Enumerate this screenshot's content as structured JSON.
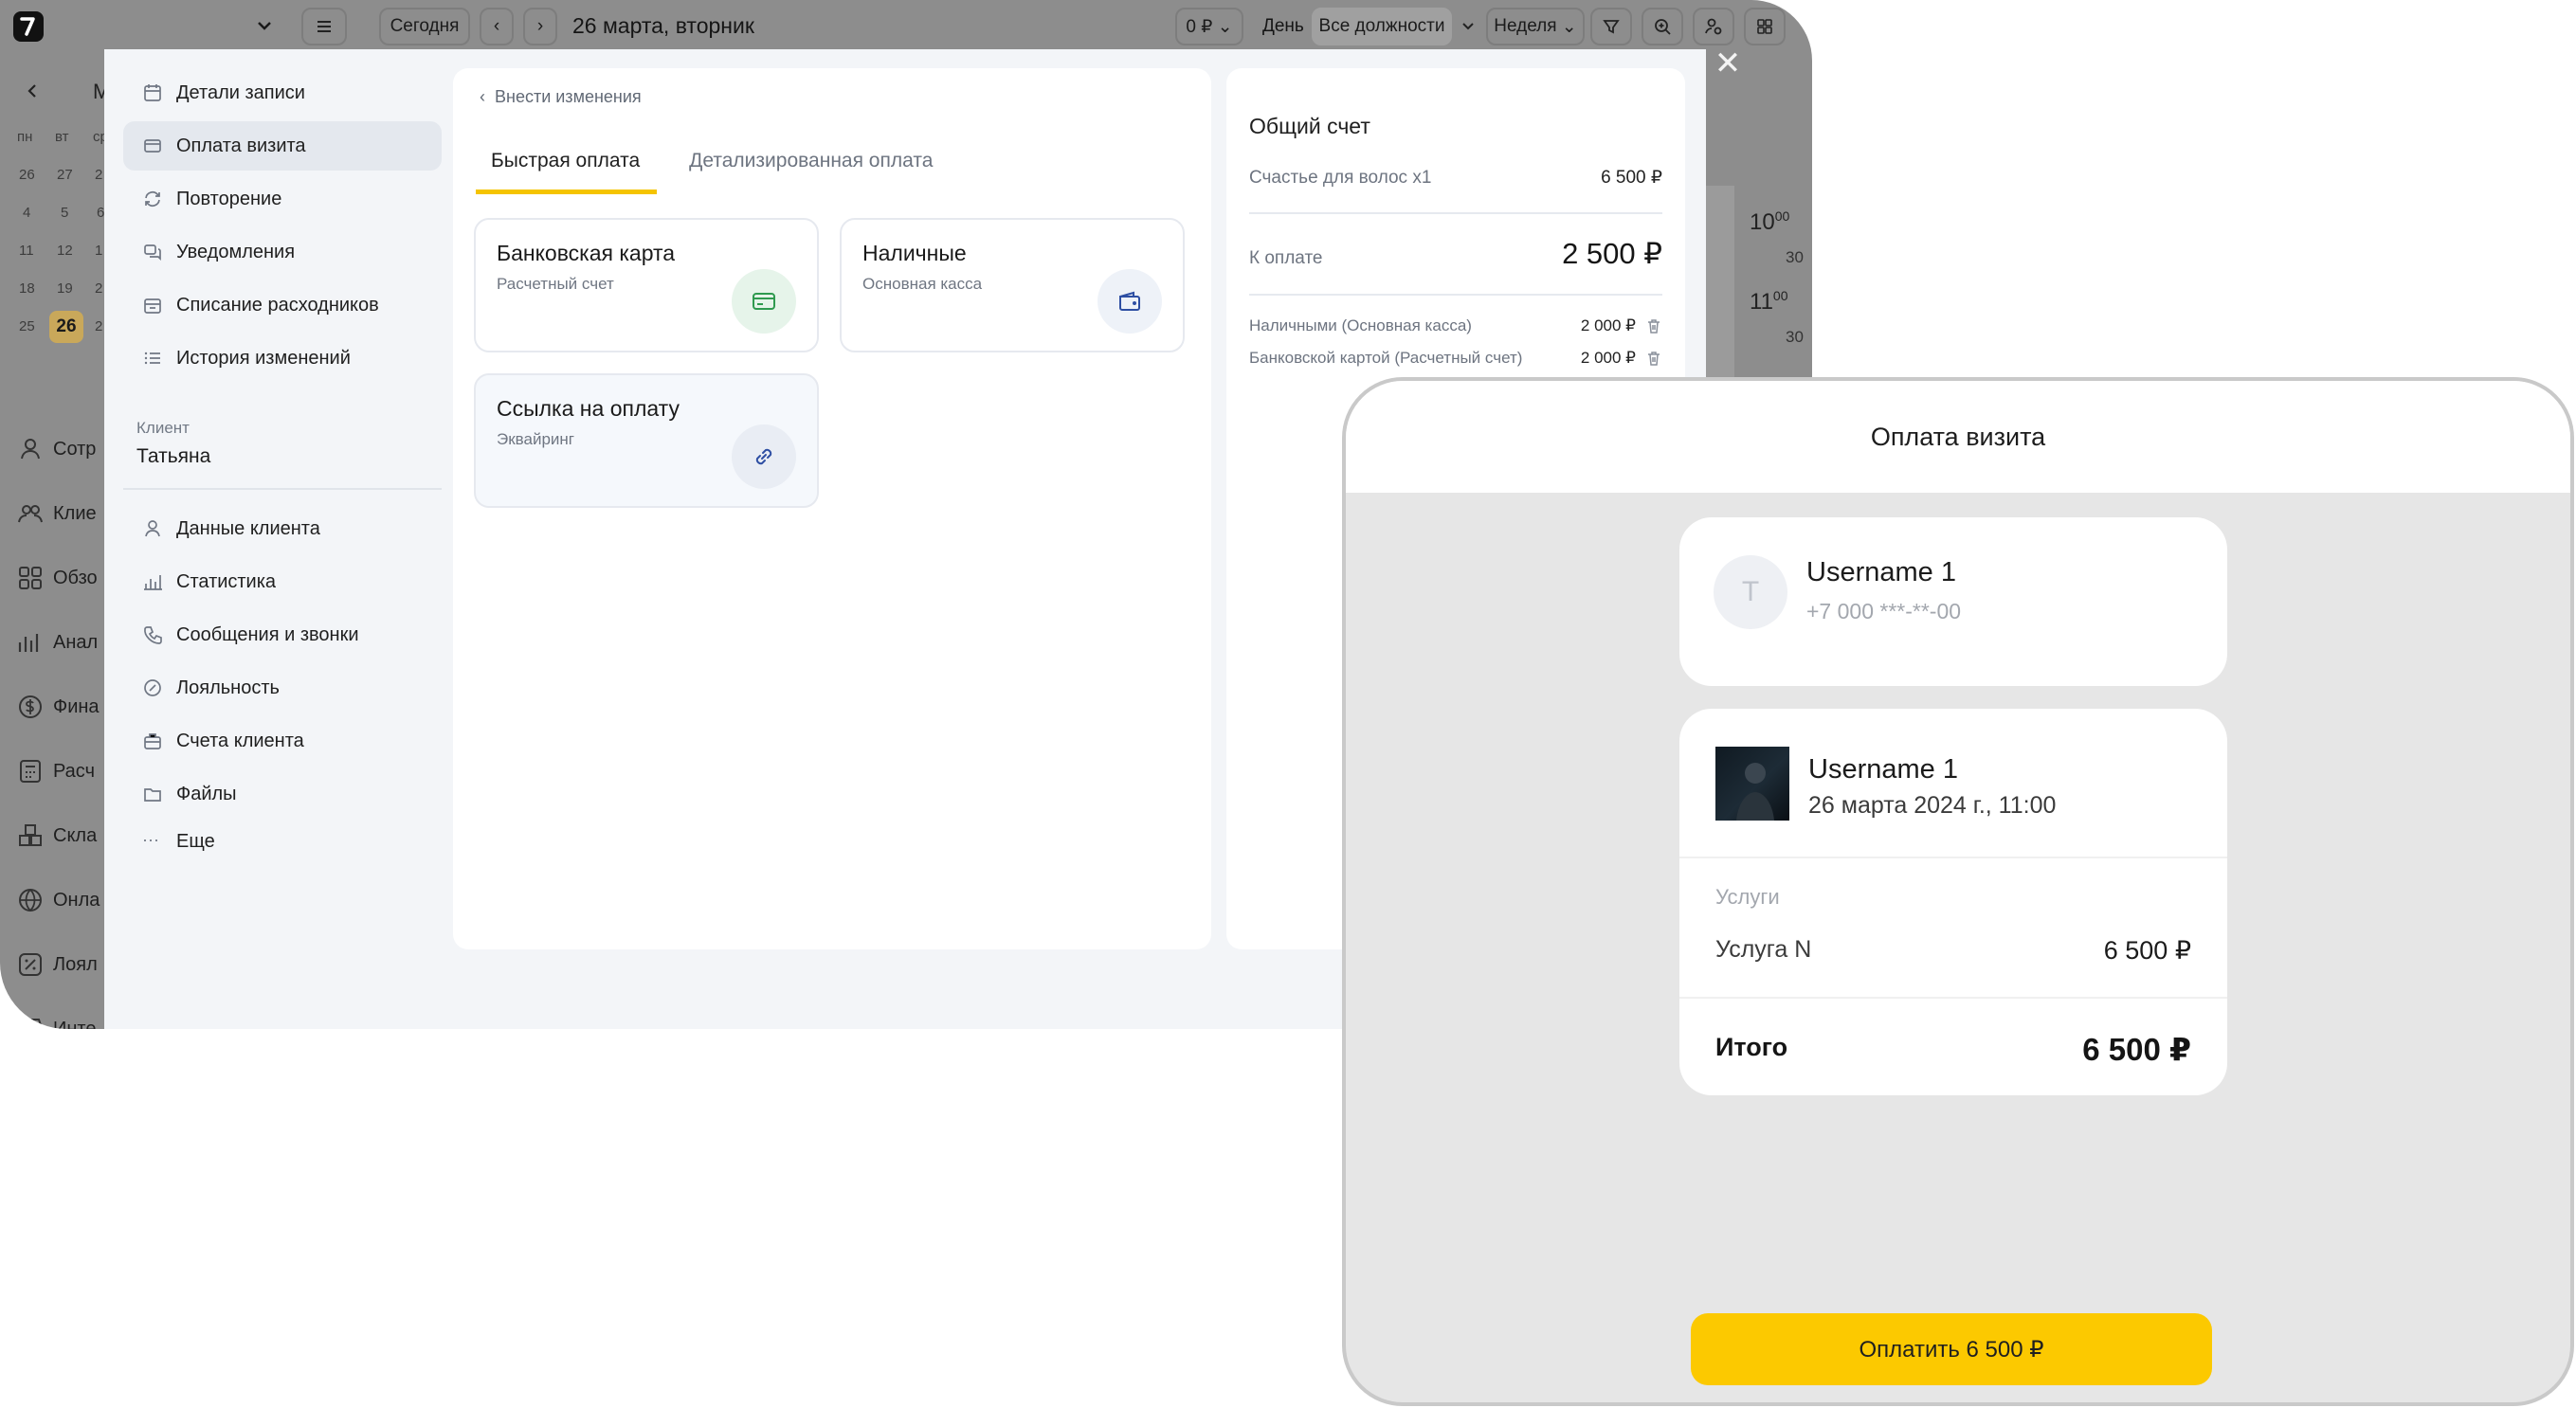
{
  "topbar": {
    "today_button": "Сегодня",
    "date": "26 марта, вторник",
    "balance": "0 ₽",
    "view_day": "День",
    "positions_filter": "Все должности",
    "view_week": "Неделя"
  },
  "calendar": {
    "month_prefix": "М",
    "weekdays": [
      "пн",
      "вт",
      "ср"
    ],
    "rows": [
      [
        "26",
        "27",
        "2"
      ],
      [
        "4",
        "5",
        "6"
      ],
      [
        "11",
        "12",
        "1"
      ],
      [
        "18",
        "19",
        "2"
      ],
      [
        "25",
        "26",
        "2"
      ]
    ],
    "selected_day": "26"
  },
  "app_sidebar": [
    "Сотр",
    "Клие",
    "Обзо",
    "Анал",
    "Фина",
    "Расч",
    "Скла",
    "Онла",
    "Лоял",
    "Инте"
  ],
  "timeline": {
    "h10": "10",
    "m10": "00",
    "m30a": "30",
    "h11": "11",
    "m11": "00",
    "m30b": "30"
  },
  "modal": {
    "menu": [
      "Детали записи",
      "Оплата визита",
      "Повторение",
      "Уведомления",
      "Списание расходников",
      "История изменений"
    ],
    "client_label": "Клиент",
    "client_name": "Татьяна",
    "menu2": [
      "Данные клиента",
      "Статистика",
      "Сообщения и звонки",
      "Лояльность",
      "Счета клиента",
      "Файлы",
      "Еще"
    ],
    "back_link": "Внести изменения",
    "tabs": {
      "quick": "Быстрая оплата",
      "detailed": "Детализированная оплата"
    },
    "methods": [
      {
        "title": "Банковская карта",
        "subtitle": "Расчетный счет"
      },
      {
        "title": "Наличные",
        "subtitle": "Основная касса"
      },
      {
        "title": "Ссылка на оплату",
        "subtitle": "Эквайринг"
      }
    ],
    "summary": {
      "title": "Общий счет",
      "service": "Счастье для волос  x1",
      "service_price": "6 500 ₽",
      "to_pay_label": "К оплате",
      "to_pay_value": "2 500 ₽",
      "payments": [
        {
          "label": "Наличными (Основная касса)",
          "amount": "2 000 ₽"
        },
        {
          "label": "Банковской картой (Расчетный счет)",
          "amount": "2 000 ₽"
        }
      ]
    }
  },
  "phone": {
    "title": "Оплата визита",
    "client": {
      "initial": "T",
      "name": "Username 1",
      "phone": "+7 000 ***-**-00"
    },
    "master": {
      "name": "Username 1",
      "datetime": "26 марта 2024 г., 11:00"
    },
    "services_label": "Услуги",
    "service_name": "Услуга N",
    "service_price": "6 500 ₽",
    "total_label": "Итого",
    "total_value": "6 500 ₽",
    "pay_button": "Оплатить 6 500 ₽"
  },
  "colors": {
    "accent": "#FCC900",
    "tab_underline": "#F5C400",
    "card_icon_bg": "#E6F4EA",
    "wallet_icon_bg": "#EEF2F8"
  }
}
